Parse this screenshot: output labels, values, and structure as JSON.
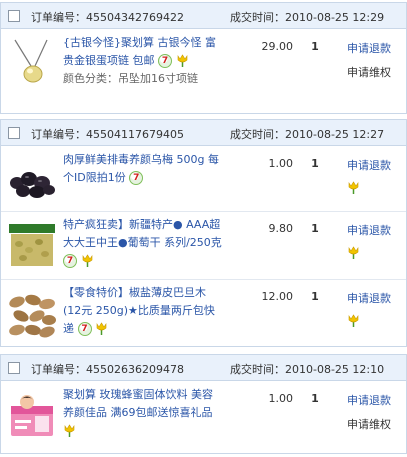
{
  "labels": {
    "order_no": "订单编号：",
    "deal_time": "成交时间：",
    "refund": "申请退款",
    "rights": "申请维权"
  },
  "orders": [
    {
      "order_no": "45504342769422",
      "deal_time": "2010-08-25 12:29",
      "items": [
        {
          "title": "{古银今怪}聚划算 古银今怪 富贵金银蛋项链 包邮",
          "variant": "颜色分类：吊坠加16寸项链",
          "price": "29.00",
          "qty": "1",
          "thumb_icon": "necklace-image"
        }
      ]
    },
    {
      "order_no": "45504117679405",
      "deal_time": "2010-08-25 12:27",
      "items": [
        {
          "title": "肉厚鲜美排毒养颜乌梅 500g 每个ID限拍1份",
          "price": "1.00",
          "qty": "1",
          "thumb_icon": "prunes-image"
        },
        {
          "title": "特产疯狂卖】新疆特产● AAA超大大王中王●葡萄干 系列/250克",
          "price": "9.80",
          "qty": "1",
          "thumb_icon": "raisins-image"
        },
        {
          "title": "【零食特价】椒盐薄皮巴旦木(12元 250g)★比质量两斤包快递",
          "price": "12.00",
          "qty": "1",
          "thumb_icon": "almonds-image"
        }
      ]
    },
    {
      "order_no": "45502636209478",
      "deal_time": "2010-08-25 12:10",
      "items": [
        {
          "title": "聚划算 玫瑰蜂蜜固体饮料 美容养颜佳品 满69包邮送惊喜礼品",
          "price": "1.00",
          "qty": "1",
          "thumb_icon": "honey-drink-image"
        }
      ]
    }
  ],
  "colors": {
    "header_bg": "#e9f1fb",
    "border": "#c9d7e8",
    "link": "#2b56a8",
    "badge_red": "#d21f1f"
  }
}
